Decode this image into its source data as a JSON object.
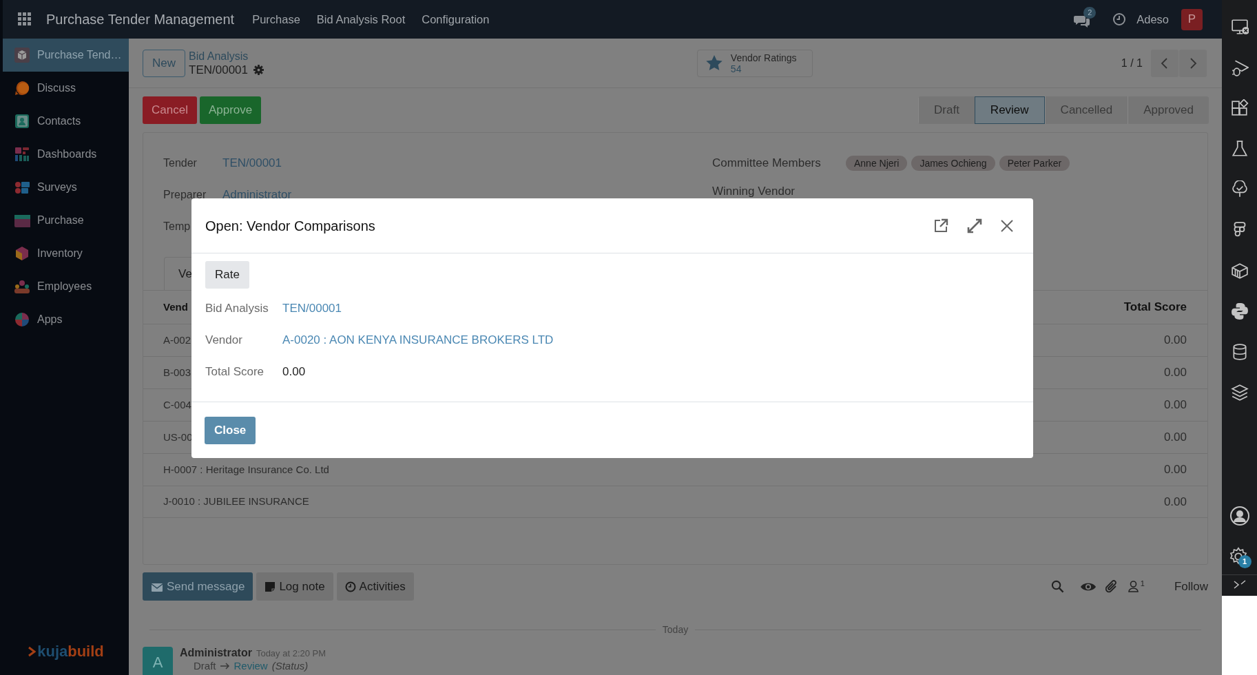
{
  "navbar": {
    "app_title": "Purchase Tender Management",
    "menus": [
      "Purchase",
      "Bid Analysis Root",
      "Configuration"
    ],
    "messages_badge": "2",
    "company": "Adeso",
    "avatar_letter": "P"
  },
  "sidebar": {
    "items": [
      {
        "label": "Purchase Tend…",
        "selected": true
      },
      {
        "label": "Discuss",
        "selected": false
      },
      {
        "label": "Contacts",
        "selected": false
      },
      {
        "label": "Dashboards",
        "selected": false
      },
      {
        "label": "Surveys",
        "selected": false
      },
      {
        "label": "Purchase",
        "selected": false
      },
      {
        "label": "Inventory",
        "selected": false
      },
      {
        "label": "Employees",
        "selected": false
      },
      {
        "label": "Apps",
        "selected": false
      }
    ],
    "logo": [
      "kuja",
      "build"
    ]
  },
  "control_panel": {
    "new_button": "New",
    "breadcrumb": "Bid Analysis",
    "record": "TEN/00001",
    "smart_button": {
      "label": "Vendor Ratings",
      "value": "54"
    },
    "pager": "1 / 1"
  },
  "actions": [
    {
      "label": "Cancel",
      "kind": "danger"
    },
    {
      "label": "Approve",
      "kind": "success"
    }
  ],
  "statusbar": [
    {
      "label": "Draft",
      "selected": false
    },
    {
      "label": "Review",
      "selected": true
    },
    {
      "label": "Cancelled",
      "selected": false
    },
    {
      "label": "Approved",
      "selected": false
    }
  ],
  "form": {
    "left_fields": [
      {
        "label": "Tender",
        "value": "TEN/00001"
      },
      {
        "label": "Preparer",
        "value": "Administrator"
      },
      {
        "label": "Temp"
      }
    ],
    "committee": {
      "label": "Committee Members",
      "tags": [
        "Anne Njeri",
        "James Ochieng",
        "Peter Parker"
      ]
    },
    "winning_vendor": {
      "label": "Winning Vendor"
    },
    "tab": "Ve",
    "table": {
      "columns": [
        "Vend",
        "Total Score"
      ],
      "rows": [
        {
          "vendor": "A-002",
          "score": "0.00"
        },
        {
          "vendor": "B-003",
          "score": "0.00"
        },
        {
          "vendor": "C-004",
          "score": "0.00"
        },
        {
          "vendor": "US-00",
          "score": "0.00"
        },
        {
          "vendor": "H-0007 : Heritage Insurance Co. Ltd",
          "score": "0.00"
        },
        {
          "vendor": "J-0010 : JUBILEE INSURANCE",
          "score": "0.00"
        }
      ]
    }
  },
  "chatter": {
    "buttons": [
      {
        "label": "Send message",
        "kind": "primary"
      },
      {
        "label": "Log note",
        "kind": "note"
      },
      {
        "label": "Activities",
        "kind": "activity"
      }
    ],
    "followers_count": "1",
    "follow": "Follow",
    "date_separator": "Today",
    "messages": [
      {
        "author": "Administrator",
        "initial": "A",
        "time": "Today at 2:20 PM",
        "old_value": "Draft",
        "new_value": "Review",
        "field": "(Status)"
      }
    ]
  },
  "dialog": {
    "title": "Open: Vendor Comparisons",
    "rate_button": "Rate",
    "fields": [
      {
        "label": "Bid Analysis",
        "value": "TEN/00001",
        "kind": "link"
      },
      {
        "label": "Vendor",
        "value": "A-0020 : AON KENYA INSURANCE BROKERS LTD",
        "kind": "link"
      },
      {
        "label": "Total Score",
        "value": "0.00",
        "kind": "text"
      }
    ],
    "close_button": "Close"
  },
  "dev_toolbar": {
    "settings_badge": "1"
  }
}
